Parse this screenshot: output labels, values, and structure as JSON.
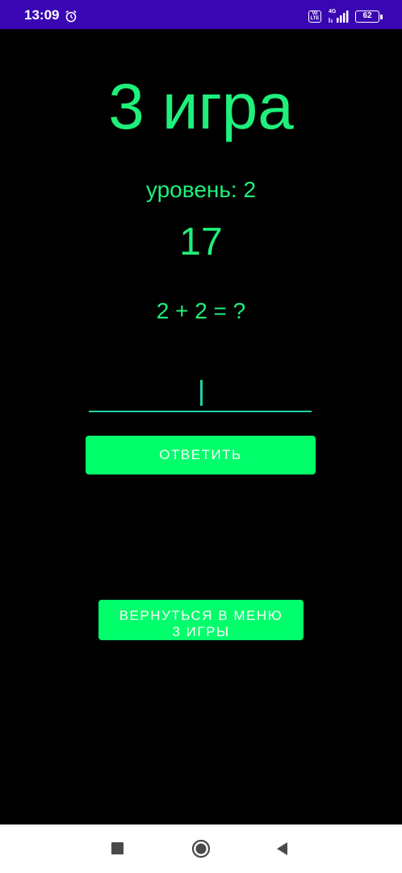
{
  "status_bar": {
    "time": "13:09",
    "volte": "Vo LTE",
    "network": "4G",
    "battery": "62",
    "background": "#3a05b3"
  },
  "game": {
    "title": "3 игра",
    "level": "уровень: 2",
    "score": "17",
    "question": "2 + 2 = ?",
    "answer_value": "",
    "accent_color": "#1ef07a"
  },
  "buttons": {
    "answer_label": "ОТВЕТИТЬ",
    "menu_label_line1": "ВЕРНУТЬСЯ В МЕНЮ",
    "menu_label_line2": "3 ИГРЫ",
    "color": "#00ff6a"
  },
  "nav_bar": {
    "icons": [
      "recents-icon",
      "home-icon",
      "back-icon"
    ]
  }
}
